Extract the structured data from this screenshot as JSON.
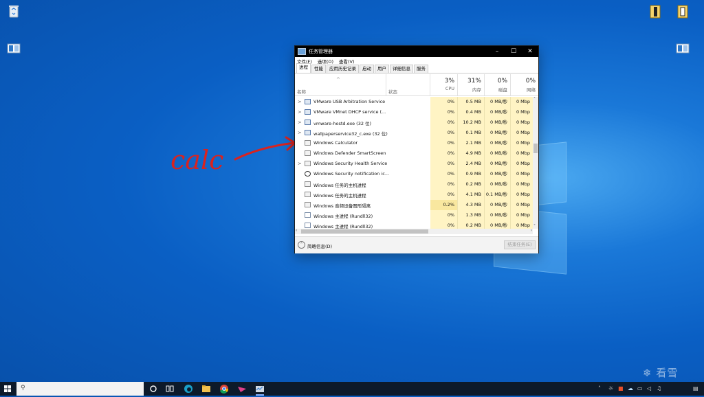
{
  "desktop": {
    "watermark_text": "看雪"
  },
  "window": {
    "title": "任务管理器",
    "menu": [
      "文件(F)",
      "选项(O)",
      "查看(V)"
    ],
    "tabs": [
      "进程",
      "性能",
      "应用历史记录",
      "启动",
      "用户",
      "详细信息",
      "服务"
    ],
    "active_tab_index": 0,
    "header": {
      "name_label": "名称",
      "status_label": "状态",
      "cpu_pct": "3%",
      "cpu_label": "CPU",
      "mem_pct": "31%",
      "mem_label": "内存",
      "disk_pct": "0%",
      "disk_label": "磁盘",
      "net_pct": "0%",
      "net_label": "网络"
    },
    "rows": [
      {
        "name": "VMware USB Arbitration Service",
        "expand": ">",
        "icon": "service-icon",
        "cpu": "0%",
        "mem": "0.5 MB",
        "disk": "0 MB/秒",
        "net": "0 Mbp"
      },
      {
        "name": "VMware VMnet DHCP service (...",
        "expand": ">",
        "icon": "service-icon",
        "cpu": "0%",
        "mem": "0.4 MB",
        "disk": "0 MB/秒",
        "net": "0 Mbp"
      },
      {
        "name": "vmware-hostd.exe (32 位)",
        "expand": ">",
        "icon": "service-icon",
        "cpu": "0%",
        "mem": "10.2 MB",
        "disk": "0 MB/秒",
        "net": "0 Mbp"
      },
      {
        "name": "wallpaperservice32_c.exe (32 位)",
        "expand": ">",
        "icon": "service-icon",
        "cpu": "0%",
        "mem": "0.1 MB",
        "disk": "0 MB/秒",
        "net": "0 Mbp"
      },
      {
        "name": "Windows Calculator",
        "expand": "",
        "icon": "app-icon",
        "cpu": "0%",
        "mem": "2.1 MB",
        "disk": "0 MB/秒",
        "net": "0 Mbp"
      },
      {
        "name": "Windows Defender SmartScreen",
        "expand": "",
        "icon": "app-icon",
        "cpu": "0%",
        "mem": "4.9 MB",
        "disk": "0 MB/秒",
        "net": "0 Mbp"
      },
      {
        "name": "Windows Security Health Service",
        "expand": ">",
        "icon": "app-icon",
        "cpu": "0%",
        "mem": "2.4 MB",
        "disk": "0 MB/秒",
        "net": "0 Mbp"
      },
      {
        "name": "Windows Security notification ic...",
        "expand": "",
        "icon": "shield-icon",
        "cpu": "0%",
        "mem": "0.9 MB",
        "disk": "0 MB/秒",
        "net": "0 Mbp"
      },
      {
        "name": "Windows 任务的主机进程",
        "expand": "",
        "icon": "app-icon",
        "cpu": "0%",
        "mem": "0.2 MB",
        "disk": "0 MB/秒",
        "net": "0 Mbp"
      },
      {
        "name": "Windows 任务的主机进程",
        "expand": "",
        "icon": "app-icon",
        "cpu": "0%",
        "mem": "4.1 MB",
        "disk": "0.1 MB/秒",
        "net": "0 Mbp"
      },
      {
        "name": "Windows 音频设备图形隔离",
        "expand": "",
        "icon": "app-icon",
        "cpu": "0.2%",
        "mem": "4.3 MB",
        "disk": "0 MB/秒",
        "net": "0 Mbp"
      },
      {
        "name": "Windows 主进程 (Rundll32)",
        "expand": "",
        "icon": "doc-icon",
        "cpu": "0%",
        "mem": "1.3 MB",
        "disk": "0 MB/秒",
        "net": "0 Mbp"
      },
      {
        "name": "Windows 主进程 (Rundll32)",
        "expand": "",
        "icon": "doc-icon",
        "cpu": "0%",
        "mem": "0.2 MB",
        "disk": "0 MB/秒",
        "net": "0 Mbp"
      }
    ],
    "footer": {
      "less_details": "简略信息(D)",
      "end_task": "结束任务(E)"
    }
  },
  "annotation": {
    "text": "calc",
    "color": "#d9231f"
  },
  "taskbar": {
    "apps": [
      "search-circle-icon",
      "task-view-icon",
      "edge-icon",
      "file-explorer-icon",
      "chrome-icon",
      "feather-app-icon",
      "task-manager-icon"
    ]
  }
}
